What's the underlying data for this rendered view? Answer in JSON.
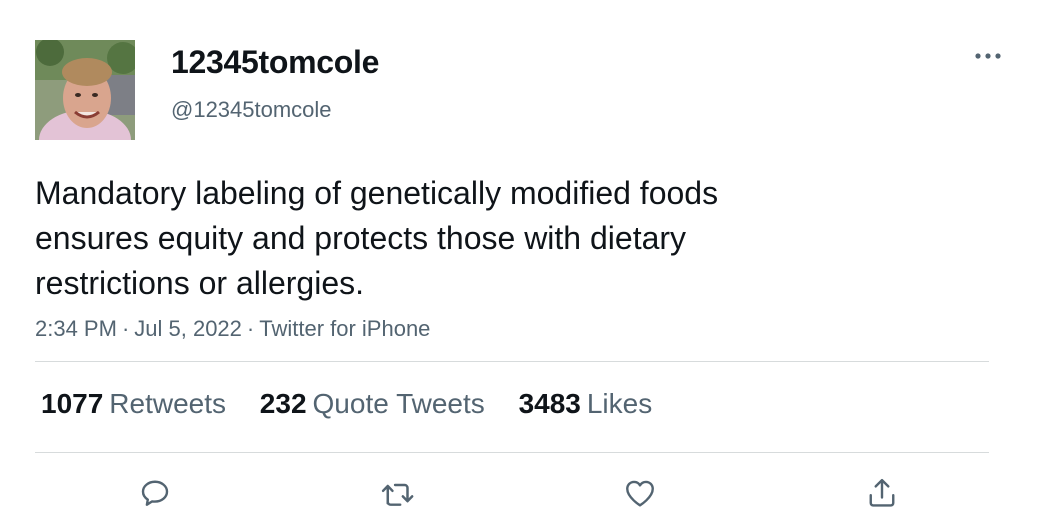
{
  "author": {
    "display_name": "12345tomcole",
    "handle": "@12345tomcole"
  },
  "tweet": {
    "text": "Mandatory labeling of genetically modified foods\nensures equity and protects those with dietary\nrestrictions or allergies.",
    "time": "2:34 PM",
    "date": "Jul 5, 2022",
    "source": "Twitter for iPhone",
    "separator": "·"
  },
  "stats": {
    "retweets": {
      "count": "1077",
      "label": "Retweets"
    },
    "quotes": {
      "count": "232",
      "label": "Quote Tweets"
    },
    "likes": {
      "count": "3483",
      "label": "Likes"
    }
  },
  "icons": {
    "more": "more-horizontal-icon",
    "reply": "reply-icon",
    "retweet": "retweet-icon",
    "like": "heart-icon",
    "share": "share-icon"
  },
  "colors": {
    "text_primary": "#0f1419",
    "text_secondary": "#536471",
    "divider": "#d7dbdc"
  }
}
